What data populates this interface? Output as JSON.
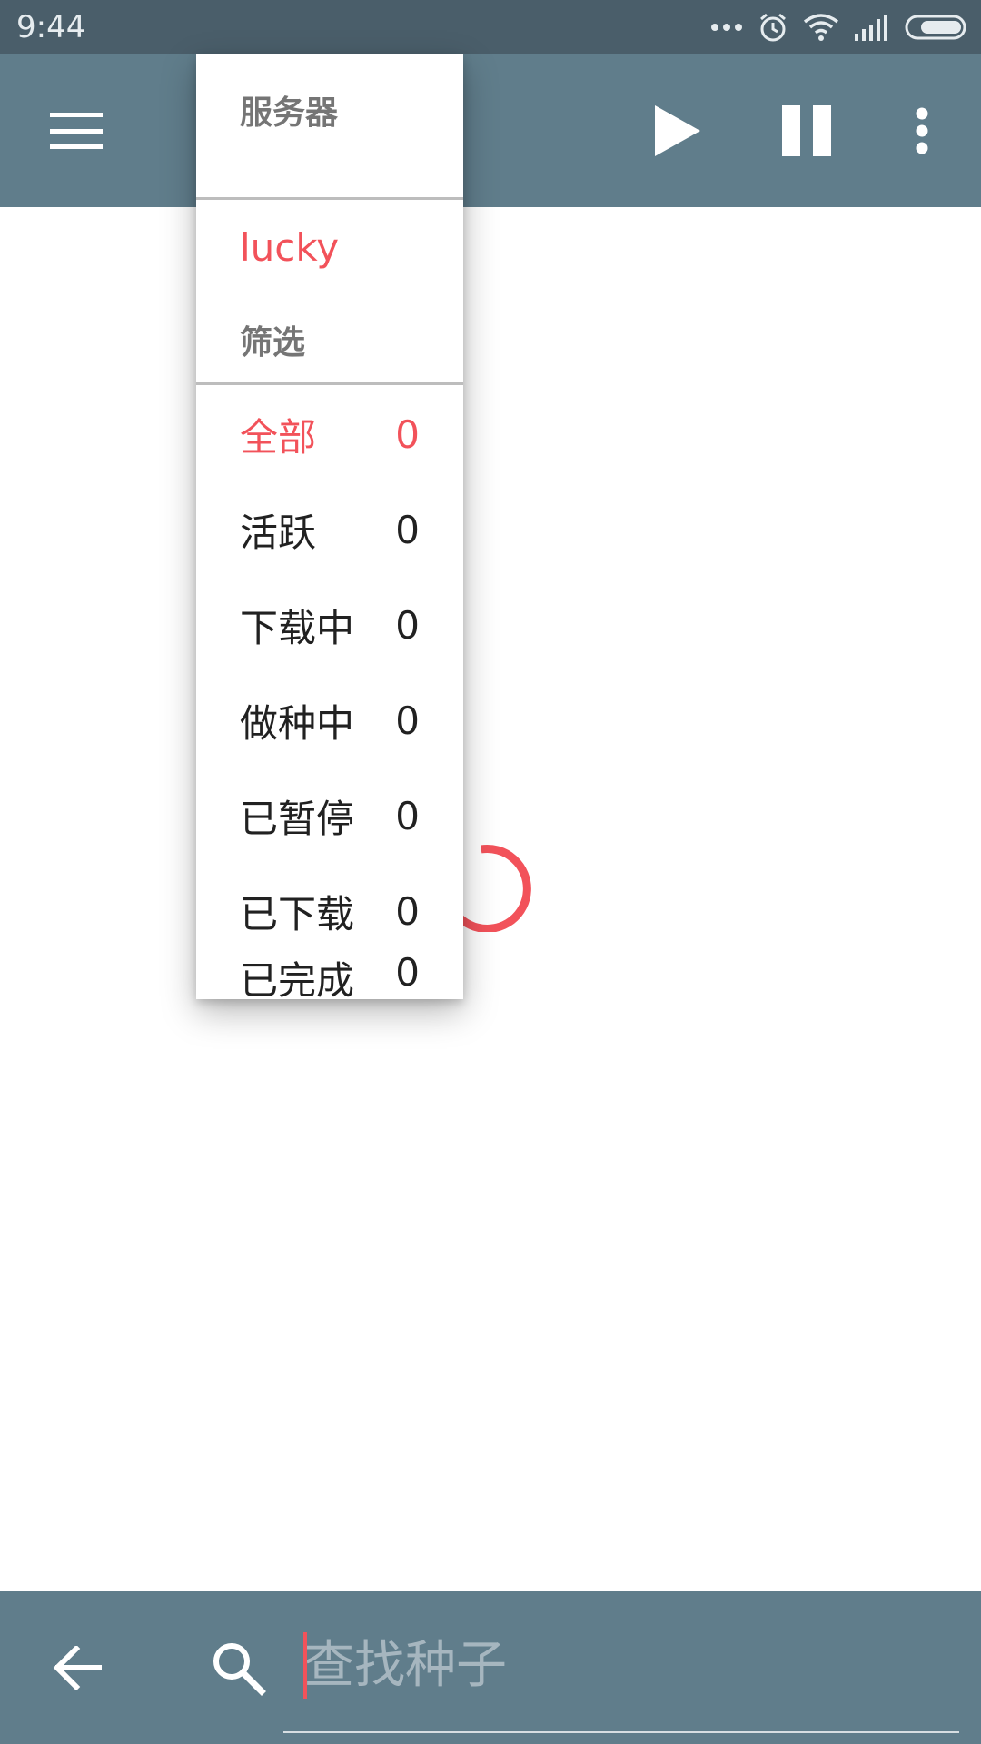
{
  "status_bar": {
    "time": "9:44",
    "icons": [
      "more-dots-icon",
      "alarm-icon",
      "wifi-icon",
      "signal-icon",
      "battery-icon"
    ]
  },
  "toolbar": {
    "menu_icon": "hamburger-menu-icon",
    "play_icon": "play-icon",
    "pause_icon": "pause-icon",
    "overflow_icon": "more-vert-icon"
  },
  "dropdown": {
    "server_header": "服务器",
    "server_name": "lucky",
    "filter_header": "筛选",
    "filters": [
      {
        "label": "全部",
        "count": "0"
      },
      {
        "label": "活跃",
        "count": "0"
      },
      {
        "label": "下载中",
        "count": "0"
      },
      {
        "label": "做种中",
        "count": "0"
      },
      {
        "label": "已暂停",
        "count": "0"
      },
      {
        "label": "已下载",
        "count": "0"
      },
      {
        "label": "已完成",
        "count": "0"
      }
    ],
    "selected_filter_index": 0
  },
  "search_bar": {
    "back_icon": "back-arrow-icon",
    "search_icon": "search-icon",
    "value": "",
    "placeholder": "查找种子"
  },
  "colors": {
    "status_bar": "#4a5e6a",
    "app_bar": "#607d8b",
    "accent": "#f2525a",
    "header_text": "#757575",
    "item_text": "#212121"
  }
}
